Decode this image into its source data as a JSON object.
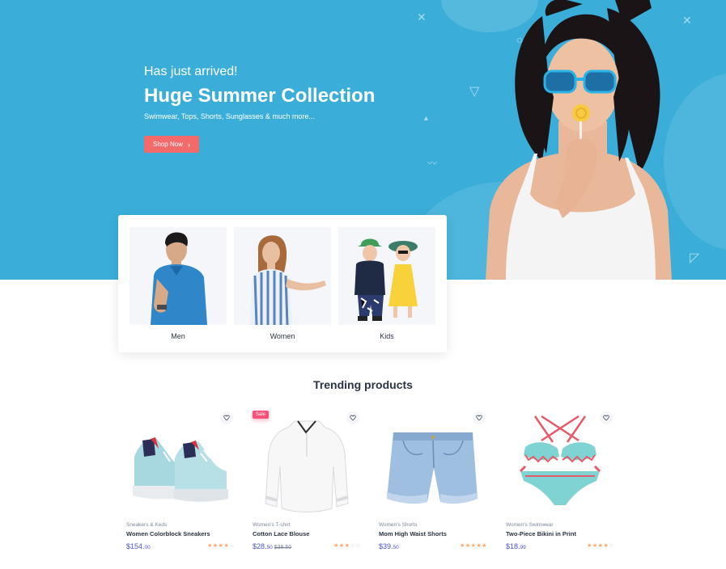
{
  "hero": {
    "eyebrow": "Has just arrived!",
    "title": "Huge Summer Collection",
    "subtitle": "Swimwear, Tops, Shorts, Sunglasses & much more...",
    "button_label": "Shop Now",
    "background_color": "#3aaed8",
    "button_color": "#f36a6a"
  },
  "categories": [
    {
      "label": "Men"
    },
    {
      "label": "Women"
    },
    {
      "label": "Kids"
    }
  ],
  "trending": {
    "title": "Trending products",
    "products": [
      {
        "category": "Sneakers & Keds",
        "name": "Women Colorblock Sneakers",
        "price_main": "$154.",
        "price_cents": "00",
        "old_price": "",
        "rating": 4,
        "badge": ""
      },
      {
        "category": "Women's T-shirt",
        "name": "Cotton Lace Blouse",
        "price_main": "$28.",
        "price_cents": "50",
        "old_price": "$38.50",
        "rating": 3,
        "badge": "Sale"
      },
      {
        "category": "Women's Shorts",
        "name": "Mom High Waist Shorts",
        "price_main": "$39.",
        "price_cents": "50",
        "old_price": "",
        "rating": 5,
        "badge": ""
      },
      {
        "category": "Women's Swimwear",
        "name": "Two-Piece Bikini in Print",
        "price_main": "$18.",
        "price_cents": "99",
        "old_price": "",
        "rating": 4,
        "badge": ""
      }
    ]
  },
  "icons": {
    "wishlist": "heart-icon",
    "button_arrow": "chevron-right-icon",
    "rating": "star-icon"
  },
  "colors": {
    "accent_price": "#4e54c8",
    "star_active": "#fea569",
    "sale_badge": "#f5517a"
  }
}
